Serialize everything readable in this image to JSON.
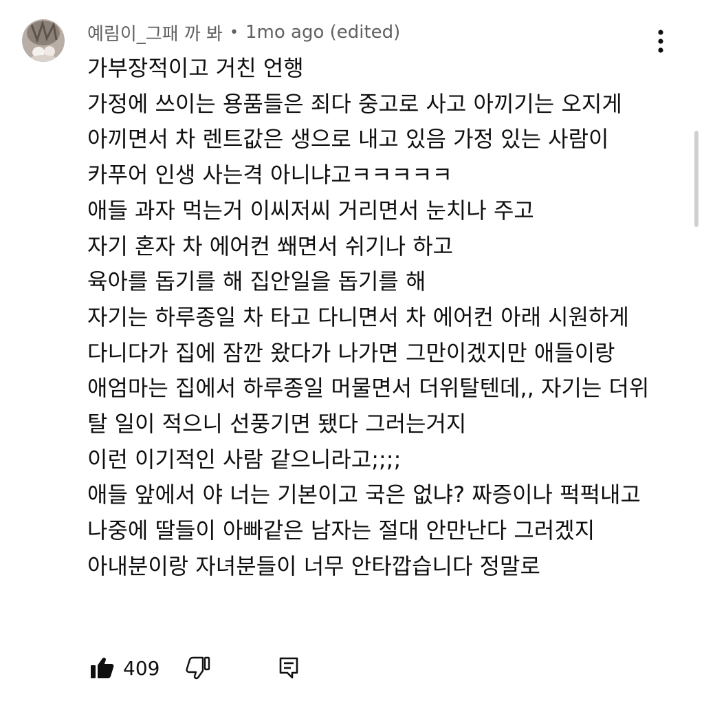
{
  "comment": {
    "author": "예림이_그패 까 봐",
    "separator": "•",
    "time": "1mo ago (edited)",
    "text": "가부장적이고 거친 언행\n가정에 쓰이는 용품들은 죄다 중고로 사고 아끼기는 오지게 아끼면서 차 렌트값은 생으로 내고 있음 가정 있는 사람이 카푸어 인생 사는격 아니냐고ㅋㅋㅋㅋㅋ\n애들 과자 먹는거 이씨저씨 거리면서 눈치나 주고\n자기 혼자 차 에어컨 쐐면서 쉬기나 하고\n육아를 돕기를 해 집안일을 돕기를 해\n자기는 하루종일 차 타고 다니면서 차 에어컨 아래 시원하게 다니다가 집에 잠깐 왔다가 나가면 그만이겠지만 애들이랑 애엄마는 집에서 하루종일 머물면서 더위탈텐데,, 자기는 더위 탈 일이 적으니 선풍기면 됐다 그러는거지\n이런 이기적인 사람 같으니라고;;;;\n애들 앞에서 야 너는 기본이고 국은 없냐? 짜증이나 퍽퍽내고\n나중에 딸들이 아빠같은 남자는 절대 안만난다 그러겠지\n아내분이랑 자녀분들이 너무 안타깝습니다 정말로",
    "like_count": "409"
  },
  "icons": {
    "avatar": "cat-avatar",
    "more": "more-vert-icon",
    "like": "thumb-up-icon",
    "dislike": "thumb-down-icon",
    "reply": "reply-comment-icon"
  },
  "colors": {
    "text": "#0f0f0f",
    "secondary_text": "#606060",
    "icon": "#0f0f0f"
  }
}
